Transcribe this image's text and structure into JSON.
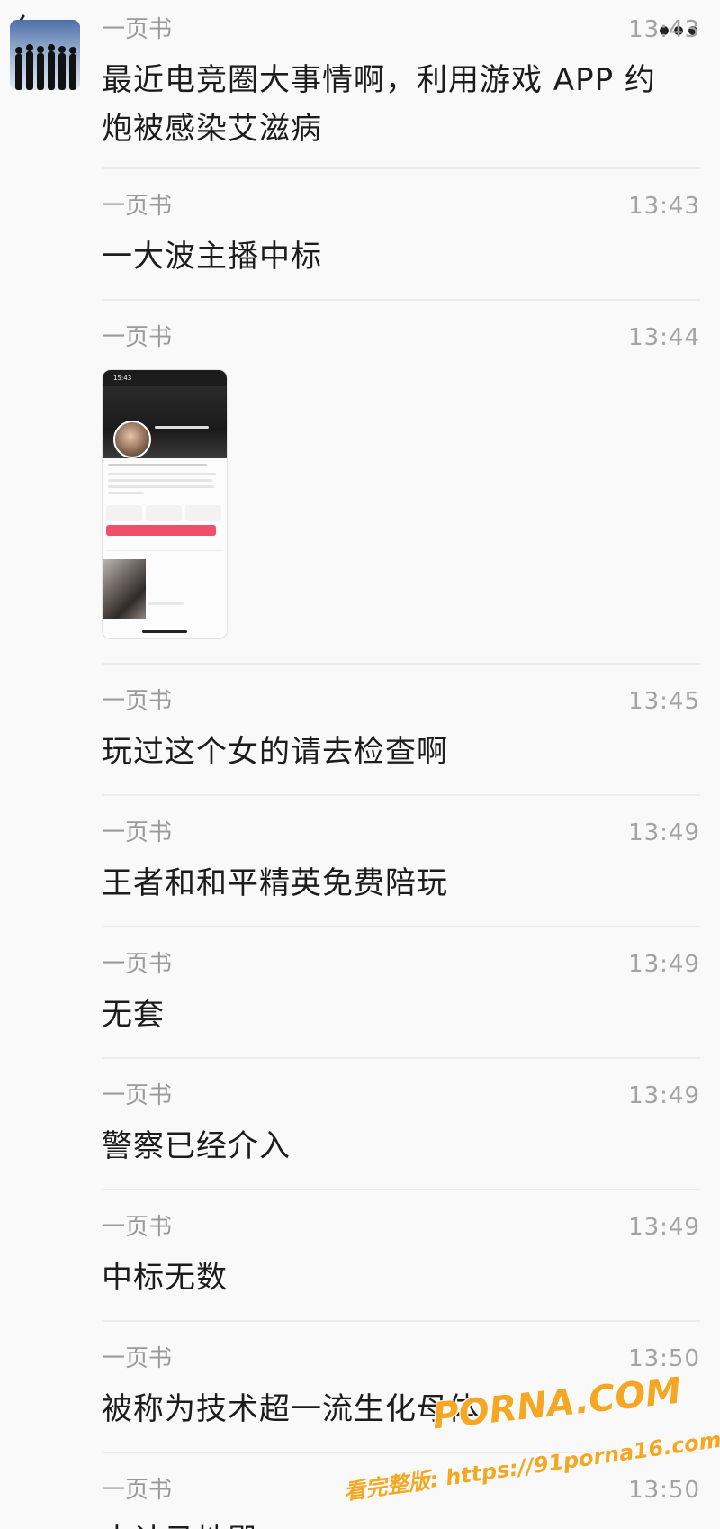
{
  "chat": {
    "messages": [
      {
        "sender": "一页书",
        "time": "13:43",
        "text": "最近电竞圈大事情啊，利用游戏 APP 约炮被感染艾滋病"
      },
      {
        "sender": "一页书",
        "time": "13:43",
        "text": "一大波主播中标"
      },
      {
        "sender": "一页书",
        "time": "13:44",
        "text": ""
      },
      {
        "sender": "一页书",
        "time": "13:45",
        "text": "玩过这个女的请去检查啊"
      },
      {
        "sender": "一页书",
        "time": "13:49",
        "text": "王者和和平精英免费陪玩"
      },
      {
        "sender": "一页书",
        "time": "13:49",
        "text": "无套"
      },
      {
        "sender": "一页书",
        "time": "13:49",
        "text": "警察已经介入"
      },
      {
        "sender": "一页书",
        "time": "13:49",
        "text": "中标无数"
      },
      {
        "sender": "一页书",
        "time": "13:50",
        "text": "被称为技术超一流生化母体"
      },
      {
        "sender": "一页书",
        "time": "13:50",
        "text": "中计马地殿"
      }
    ]
  },
  "image_message": {
    "status_time": "15:43"
  },
  "watermark": {
    "brand": "PORNA.COM",
    "url": "看完整版: https://91porna16.com"
  },
  "icons": {
    "back": "chevron-left-icon",
    "more": "more-dots-icon",
    "avatar": "group-silhouette-avatar"
  },
  "colors": {
    "sender": "#9a9a9a",
    "time": "#a3a3a3",
    "text": "#1c1c1c",
    "watermark": "#f5a623"
  }
}
